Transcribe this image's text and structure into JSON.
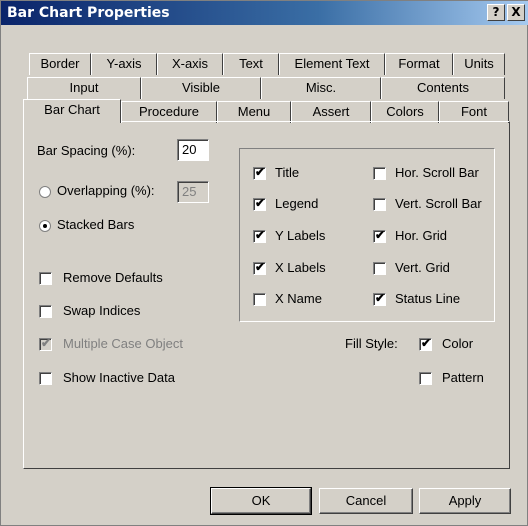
{
  "window": {
    "title": "Bar Chart Properties",
    "help_label": "?",
    "close_label": "X"
  },
  "tabs": {
    "row1": [
      "Border",
      "Y-axis",
      "X-axis",
      "Text",
      "Element Text",
      "Format",
      "Units"
    ],
    "row2": [
      "Input",
      "Visible",
      "Misc.",
      "Contents"
    ],
    "row3": [
      "Bar Chart",
      "Procedure",
      "Menu",
      "Assert",
      "Colors",
      "Font"
    ],
    "active": "Bar Chart"
  },
  "bar_spacing": {
    "label": "Bar Spacing (%):",
    "value": "20"
  },
  "overlapping": {
    "label": "Overlapping (%):",
    "value": "25",
    "selected": false
  },
  "stacked": {
    "label": "Stacked Bars",
    "selected": true
  },
  "options": {
    "remove_defaults": {
      "label": "Remove Defaults",
      "checked": false
    },
    "swap_indices": {
      "label": "Swap Indices",
      "checked": false
    },
    "multiple_case": {
      "label": "Multiple Case Object",
      "checked": true,
      "disabled": true
    },
    "show_inactive": {
      "label": "Show Inactive Data",
      "checked": false
    }
  },
  "display": {
    "title": {
      "label": "Title",
      "checked": true
    },
    "legend": {
      "label": "Legend",
      "checked": true
    },
    "y_labels": {
      "label": "Y Labels",
      "checked": true
    },
    "x_labels": {
      "label": "X Labels",
      "checked": true
    },
    "x_name": {
      "label": "X Name",
      "checked": false
    },
    "hor_scroll": {
      "label": "Hor. Scroll Bar",
      "checked": false
    },
    "vert_scroll": {
      "label": "Vert. Scroll Bar",
      "checked": false
    },
    "hor_grid": {
      "label": "Hor. Grid",
      "checked": true
    },
    "vert_grid": {
      "label": "Vert. Grid",
      "checked": false
    },
    "status_line": {
      "label": "Status Line",
      "checked": true
    }
  },
  "fill_style": {
    "label": "Fill Style:",
    "color": {
      "label": "Color",
      "checked": true
    },
    "pattern": {
      "label": "Pattern",
      "checked": false
    }
  },
  "buttons": {
    "ok": "OK",
    "cancel": "Cancel",
    "apply": "Apply"
  },
  "check_glyph": "✔"
}
